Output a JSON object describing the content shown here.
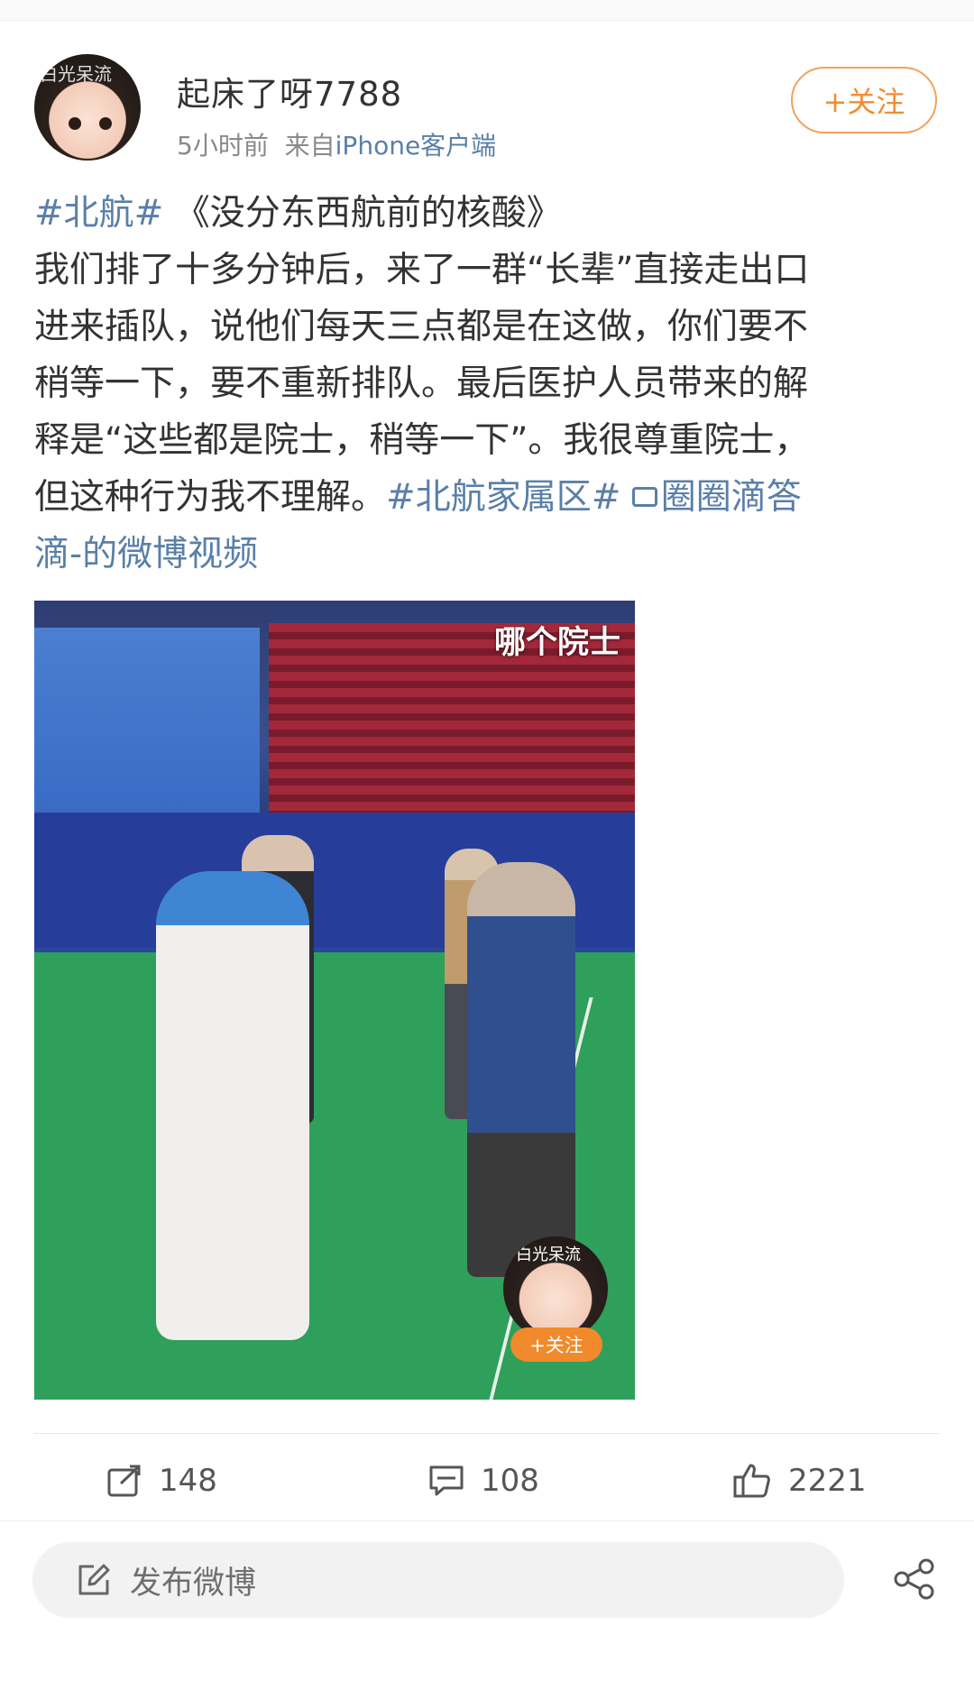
{
  "author": {
    "avatar_watermark": "白光呆流",
    "name": "起床了呀7788",
    "time": "5小时前",
    "source_prefix": "来自",
    "source": "iPhone客户端",
    "follow_label": "+关注"
  },
  "post": {
    "line1_tag": "#北航#",
    "line1_text": "《没分东西航前的核酸》",
    "line2": "我们排了十多分钟后，来了一群“长辈”直接走出口",
    "line3": "进来插队，说他们每天三点都是在这做，你们要不",
    "line4": "稍等一下，要不重新排队。最后医护人员带来的解",
    "line5": "释是“这些都是院士，稍等一下”。我很尊重院士，",
    "line6_text": "但这种行为我不理解。",
    "line6_tag": "#北航家属区#",
    "line6_link": "圈圈滴答",
    "line7_link": "滴-的微博视频"
  },
  "media": {
    "caption": "哪个院士",
    "mini_avatar_watermark": "白光呆流",
    "mini_follow_label": "+关注"
  },
  "actions": {
    "repost_count": "148",
    "comment_count": "108",
    "like_count": "2221"
  },
  "compose": {
    "placeholder": "发布微博"
  },
  "colors": {
    "link": "#5a7fa8",
    "follow_orange": "#f28d30",
    "text": "#333333",
    "meta": "#8a8a8a"
  }
}
